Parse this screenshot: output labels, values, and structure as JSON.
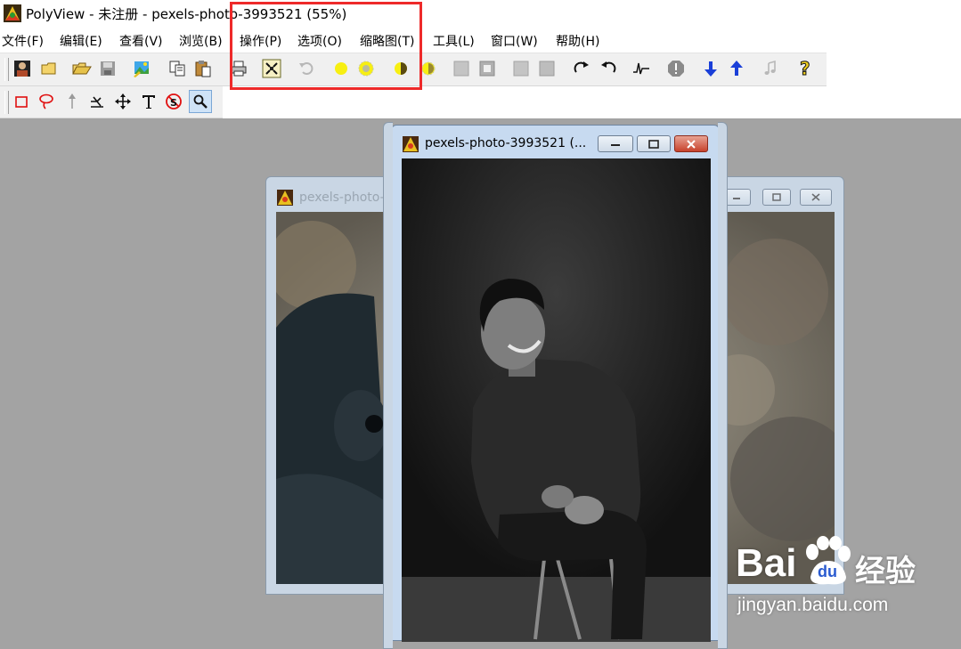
{
  "app": {
    "title": "PolyView - 未注册 - pexels-photo-3993521 (55%)"
  },
  "menu": {
    "items": [
      "文件(F)",
      "编辑(E)",
      "查看(V)",
      "浏览(B)",
      "操作(P)",
      "选项(O)",
      "缩略图(T)",
      "工具(L)",
      "窗口(W)",
      "帮助(H)"
    ]
  },
  "toolbar": {
    "main_icons": [
      "portrait-icon",
      "open-folder-icon",
      "open-file-icon",
      "save-icon",
      "image-adjust-icon",
      "copy-icon",
      "paste-icon",
      "print-icon",
      "fit-window-icon",
      "undo-icon",
      "brightness-icon",
      "brightness-ring-icon",
      "contrast-half-icon",
      "contrast-ring-icon",
      "gray-square-icon",
      "inner-square-icon",
      "gray-square-2-icon",
      "gray-square-3-icon",
      "rotate-cw-icon",
      "rotate-ccw-icon",
      "levels-icon",
      "block-icon",
      "arrow-down-icon",
      "arrow-up-icon",
      "music-note-icon",
      "help-icon"
    ],
    "tool_icons": [
      "rect-select-icon",
      "lasso-icon",
      "arrow-up-thin-icon",
      "crop-angle-icon",
      "move-icon",
      "text-tool-icon",
      "stamp-icon",
      "magnify-icon"
    ],
    "active_tool": "magnify-icon"
  },
  "windows": {
    "front_title": "pexels-photo-3993521 (...",
    "back_title": "pexels-photo-"
  },
  "watermark": {
    "brand": "Bai",
    "paw": "du",
    "cn": "经验",
    "url": "jingyan.baidu.com"
  },
  "colors": {
    "highlight": "#ee2a2a",
    "blue_arrow": "#1a3fd8",
    "workspace": "#a3a3a3"
  }
}
